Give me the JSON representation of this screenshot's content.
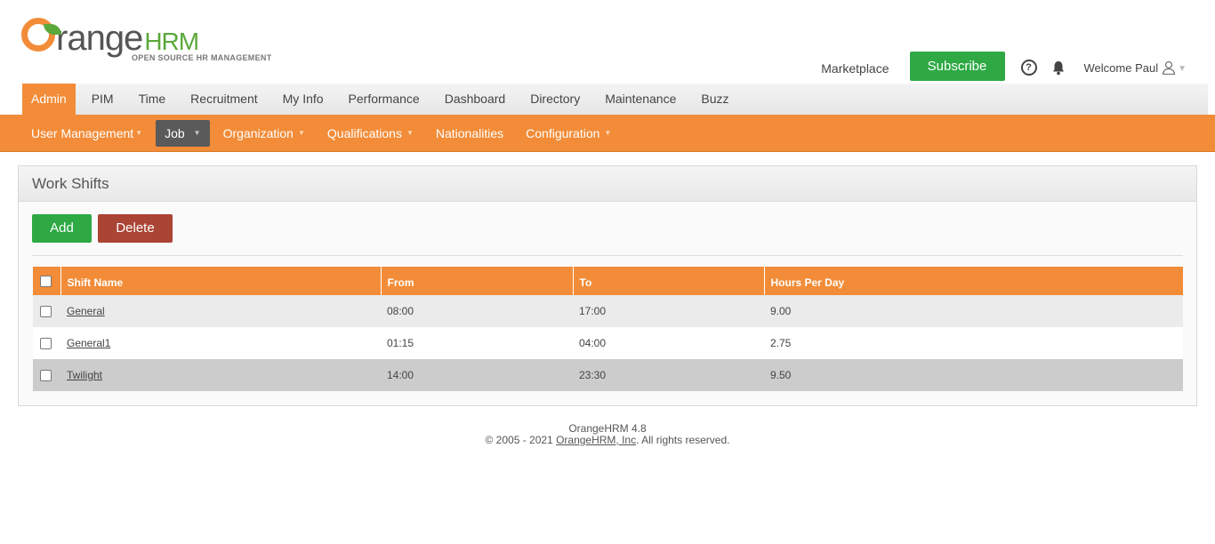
{
  "brand": {
    "logo_main": "range",
    "logo_hrm": "HRM",
    "logo_sub": "OPEN SOURCE HR MANAGEMENT"
  },
  "header": {
    "marketplace": "Marketplace",
    "subscribe": "Subscribe",
    "welcome": "Welcome Paul"
  },
  "main_menu": [
    "Admin",
    "PIM",
    "Time",
    "Recruitment",
    "My Info",
    "Performance",
    "Dashboard",
    "Directory",
    "Maintenance",
    "Buzz"
  ],
  "sub_menu": {
    "user_management": "User Management",
    "job": "Job",
    "organization": "Organization",
    "qualifications": "Qualifications",
    "nationalities": "Nationalities",
    "configuration": "Configuration"
  },
  "panel": {
    "title": "Work Shifts",
    "add": "Add",
    "delete": "Delete"
  },
  "table": {
    "headers": [
      "Shift Name",
      "From",
      "To",
      "Hours Per Day"
    ],
    "rows": [
      {
        "name": "General",
        "from": "08:00",
        "to": "17:00",
        "hours": "9.00"
      },
      {
        "name": "General1",
        "from": "01:15",
        "to": "04:00",
        "hours": "2.75"
      },
      {
        "name": "Twilight",
        "from": "14:00",
        "to": "23:30",
        "hours": "9.50"
      }
    ]
  },
  "footer": {
    "version": "OrangeHRM 4.8",
    "copyright_prefix": "© 2005 - 2021 ",
    "company": "OrangeHRM, Inc",
    "copyright_suffix": ". All rights reserved."
  },
  "colors": {
    "accent": "#f28c38",
    "green": "#2ea944",
    "red": "#aa4435"
  }
}
